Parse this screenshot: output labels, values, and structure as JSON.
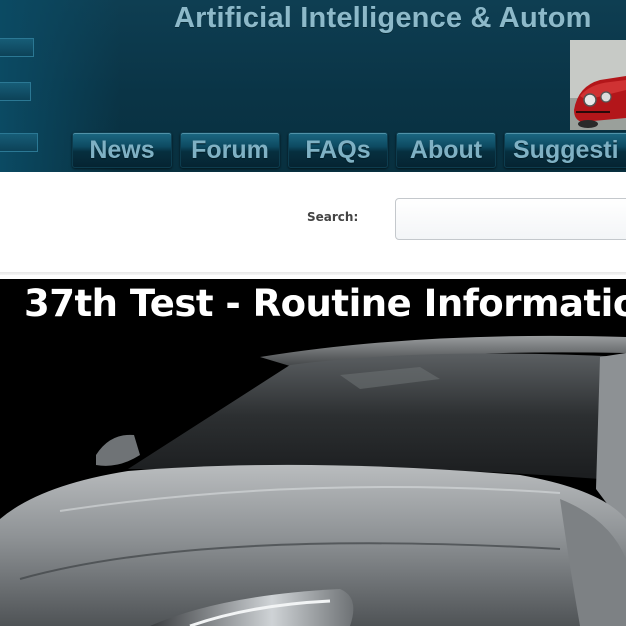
{
  "header": {
    "site_title": "Artificial Intelligence & Autom",
    "nav": [
      {
        "label": "News"
      },
      {
        "label": "Forum"
      },
      {
        "label": "FAQs"
      },
      {
        "label": "About"
      },
      {
        "label": "Suggesti"
      }
    ]
  },
  "search": {
    "label": "Search:",
    "value": "",
    "placeholder": ""
  },
  "hero": {
    "title": "37th Test - Routine Informatio"
  },
  "colors": {
    "banner": "#0a3446",
    "nav_text": "#7fb1c4",
    "title_text": "#8db9c9",
    "hero_bg": "#000000"
  }
}
